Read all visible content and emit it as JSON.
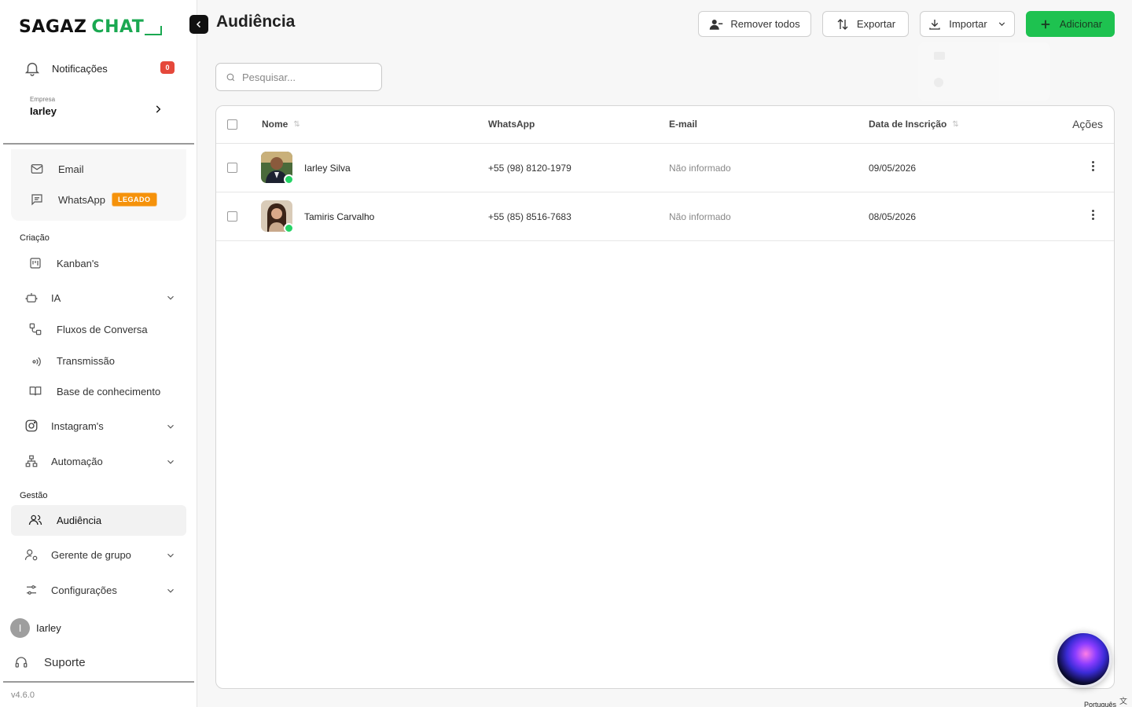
{
  "brand": {
    "part1": "SAGAZ",
    "part2": "CHAT"
  },
  "sidebar": {
    "notifications": {
      "label": "Notificações",
      "count": "0"
    },
    "company": {
      "caption": "Empresa",
      "name": "Iarley"
    },
    "legacy_items": [
      {
        "label": "Email",
        "icon": "mail-icon"
      },
      {
        "label": "WhatsApp",
        "badge": "LEGADO",
        "icon": "message-square-icon"
      }
    ],
    "sections": {
      "creation": "Criação",
      "management": "Gestão"
    },
    "items": {
      "kanban": "Kanban's",
      "ia": "IA",
      "flows": "Fluxos de Conversa",
      "broadcast": "Transmissão",
      "knowledge": "Base de conhecimento",
      "instagram": "Instagram's",
      "automation": "Automação",
      "audience": "Audiência",
      "group_manager": "Gerente de grupo",
      "settings": "Configurações"
    },
    "user": {
      "initial": "I",
      "name": "Iarley"
    },
    "support": "Suporte",
    "version": "v4.6.0"
  },
  "page": {
    "title": "Audiência",
    "search_placeholder": "Pesquisar..."
  },
  "toolbar": {
    "remove_all": "Remover todos",
    "export": "Exportar",
    "import": "Importar",
    "add": "Adicionar"
  },
  "table": {
    "columns": {
      "name": "Nome",
      "whatsapp": "WhatsApp",
      "email": "E-mail",
      "date": "Data de Inscrição",
      "actions": "Ações"
    },
    "rows": [
      {
        "name": "Iarley Silva",
        "whatsapp": "+55 (98) 8120-1979",
        "email": "Não informado",
        "date": "09/05/2026"
      },
      {
        "name": "Tamiris Carvalho",
        "whatsapp": "+55 (85) 8516-7683",
        "email": "Não informado",
        "date": "08/05/2026"
      }
    ]
  },
  "footer": {
    "language": "Português"
  },
  "colors": {
    "accent": "#1ec250",
    "badge_red": "#e5483b",
    "legacy_orange": "#f5920b"
  }
}
